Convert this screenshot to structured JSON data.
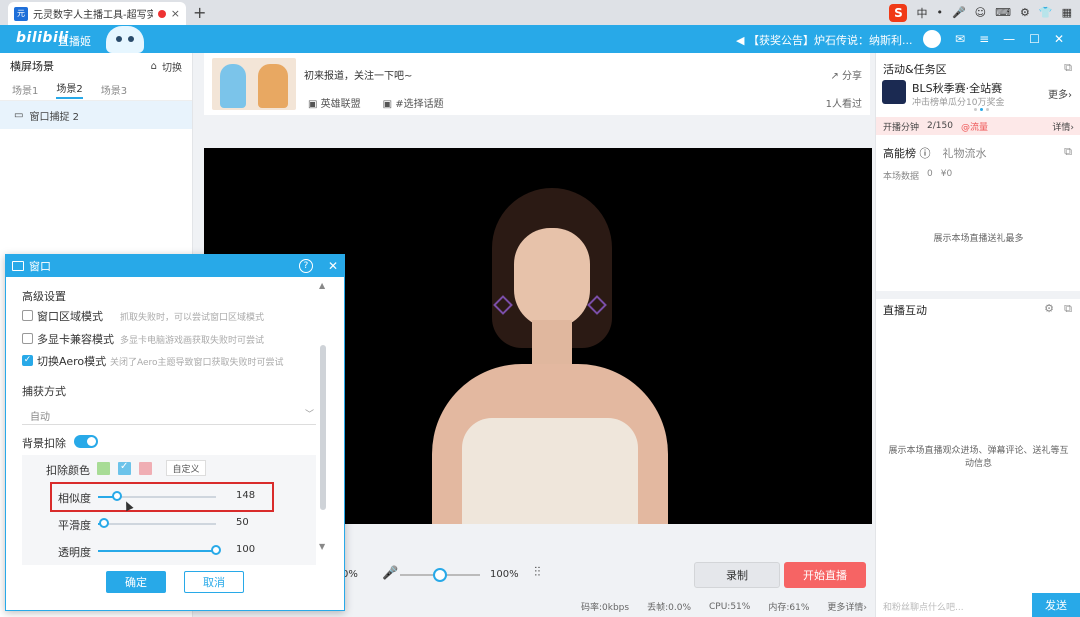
{
  "browser": {
    "tab_title": "元灵数字人主播工具-超写实...",
    "favicon": "元",
    "new_tab": "+",
    "close": "×",
    "tray": {
      "ime_logo": "S",
      "ime_lang": "中",
      "punct": "•",
      "mic": "🎤",
      "smile": "☺",
      "keyboard": "⌨",
      "settings": "⚙",
      "shirt": "👕",
      "grid": "▦"
    }
  },
  "app": {
    "logo": "bilibili",
    "logo_sub": "直播姬",
    "announcement": "【获奖公告】炉石传说：纳斯利...",
    "window_icons": {
      "announce": "◀",
      "mail": "✉",
      "menu": "≡",
      "min": "—",
      "max": "☐",
      "close": "✕"
    }
  },
  "left_panel": {
    "title": "横屏场景",
    "switch_label": "切换",
    "scenes": [
      "场景1",
      "场景2",
      "场景3"
    ],
    "active_scene": 1,
    "source_item": "窗口捕捉 2"
  },
  "info_card": {
    "stream_title": "初来报道，关注一下吧~",
    "category": "英雄联盟",
    "topic": "#选择话题",
    "share": "分享",
    "viewers": "1人看过"
  },
  "controls": {
    "left_percent": "0%",
    "mic_volume": "100%",
    "mic_level": 0.5,
    "record": "录制",
    "go_live": "开始直播"
  },
  "status": {
    "bitrate": "码率:0kbps",
    "drop": "丢帧:0.0%",
    "cpu": "CPU:51%",
    "memory": "内存:61%",
    "more": "更多详情›"
  },
  "right_panel": {
    "activity_title": "活动&任务区",
    "event_title": "BLS秋季赛·全站赛",
    "event_sub": "冲击榜单瓜分10万奖金",
    "more": "更多›",
    "progress_label": "开播分钟",
    "progress_value": "2/150",
    "progress_unit": "@流量",
    "details": "详情›",
    "rank_tab": "高能榜",
    "gift_tab": "礼物流水",
    "stats_label": "本场数据",
    "stats_count": "0",
    "stats_money": "¥0",
    "empty_rank": "展示本场直播送礼最多",
    "interact_title": "直播互动",
    "empty_interact": "展示本场直播观众进场、弹幕评论、送礼等互动信息",
    "chat_placeholder": "和粉丝聊点什么吧...",
    "send": "发送"
  },
  "dialog": {
    "title": "窗口",
    "help": "?",
    "advanced_title": "高级设置",
    "options": [
      {
        "label": "窗口区域模式",
        "hint": "抓取失败时，可以尝试窗口区域模式",
        "checked": false
      },
      {
        "label": "多显卡兼容模式",
        "hint": "多显卡电脑游戏画获取失败时可尝试",
        "checked": false
      },
      {
        "label": "切换Aero模式",
        "hint": "关闭了Aero主题导致窗口获取失败时可尝试",
        "checked": true
      }
    ],
    "capture_label": "捕获方式",
    "capture_value": "自动",
    "bg_remove_label": "背景扣除",
    "bg_remove_on": true,
    "remove_color_label": "扣除颜色",
    "swatches": [
      "#a8dc96",
      "#6cc3ea",
      "#f0aeb4"
    ],
    "selected_swatch": 1,
    "custom_label": "自定义",
    "sliders": [
      {
        "label": "相似度",
        "value": "148",
        "level": 0.16
      },
      {
        "label": "平滑度",
        "value": "50",
        "level": 0.05
      },
      {
        "label": "透明度",
        "value": "100",
        "level": 1.0
      }
    ],
    "ok": "确定",
    "cancel": "取消"
  }
}
